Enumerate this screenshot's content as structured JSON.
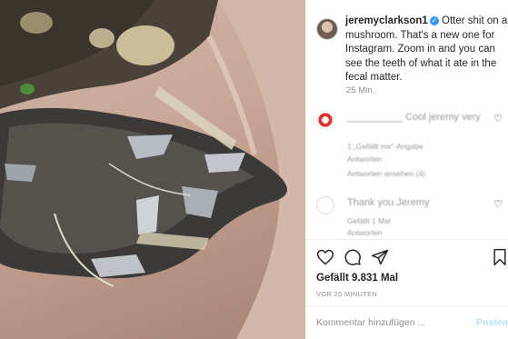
{
  "post": {
    "username": "jeremyclarkson1",
    "verified_mark": "✓",
    "caption": "Otter shit on a mushroom. That's a new one for Instagram. Zoom in and you can see the teeth of what it ate in the fecal matter.",
    "time": "25 Min."
  },
  "comments": [
    {
      "text": "__________ Cool jeremy very",
      "likes": "1 „Gefällt mir“-Angabe",
      "reply": "Antworten",
      "view_replies": "Antworten ansehen (4)",
      "heart_icon": "heart-outline-icon"
    },
    {
      "text": "Thank you Jeremy",
      "likes": "Gefällt 1 Mal",
      "reply": "Antworten",
      "heart_icon": "heart-outline-icon"
    }
  ],
  "actions": {
    "like_icon": "heart-outline-icon",
    "comment_icon": "comment-bubble-icon",
    "share_icon": "paper-plane-icon",
    "save_icon": "bookmark-icon"
  },
  "likes_text": "Gefällt 9.831 Mal",
  "posted_ago": "VOR 25 MINUTEN",
  "comment_input": {
    "placeholder": "Kommentar hinzufügen ...",
    "post_label": "Posten"
  },
  "colors": {
    "verified": "#3897f0",
    "post_button": "#b2dffc",
    "secondary_text": "#8e8e8e"
  }
}
